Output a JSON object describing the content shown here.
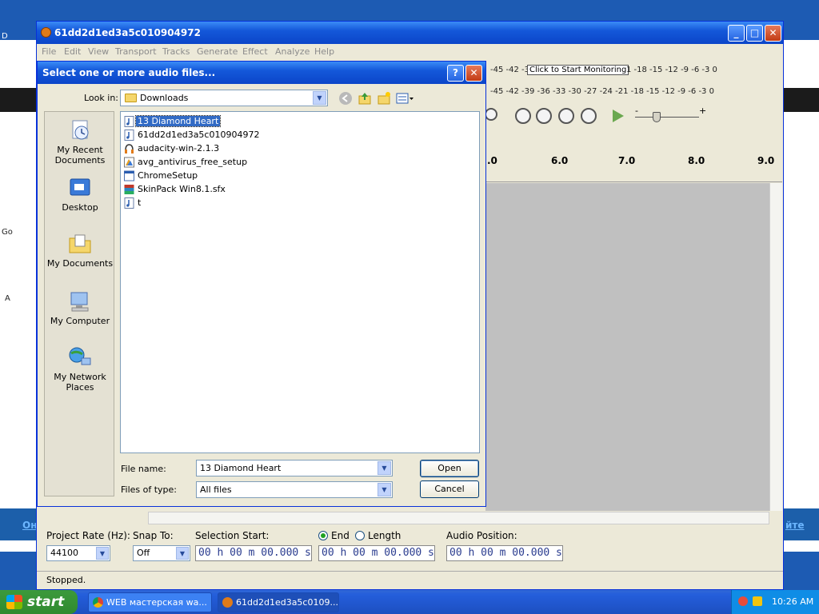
{
  "app": {
    "title": "61dd2d1ed3a5c010904972",
    "menu": [
      "File",
      "Edit",
      "View",
      "Transport",
      "Tracks",
      "Generate",
      "Effect",
      "Analyze",
      "Help"
    ],
    "meter_top": "-45 -42 -3",
    "meter_top_right": "1 -18 -15 -12  -9  -6  -3  0",
    "monitor_tip": "Click to Start Monitoring",
    "meter_bottom": "-45 -42 -39 -36 -33 -30 -27 -24 -21 -18 -15 -12  -9  -6  -3  0",
    "ruler": [
      ".0",
      "6.0",
      "7.0",
      "8.0",
      "9.0"
    ],
    "slider_minus": "-",
    "slider_plus": "+",
    "project_rate_label": "Project Rate (Hz):",
    "project_rate": "44100",
    "snap_to_label": "Snap To:",
    "snap_to": "Off",
    "selection_start_label": "Selection Start:",
    "end_label": "End",
    "length_label": "Length",
    "audio_position_label": "Audio Position:",
    "time_value": "00 h 00 m 00.000 s",
    "status": "Stopped."
  },
  "dialog": {
    "title": "Select one or more audio files...",
    "look_in_label": "Look in:",
    "look_in": "Downloads",
    "places": [
      "My Recent Documents",
      "Desktop",
      "My Documents",
      "My Computer",
      "My Network Places"
    ],
    "files": [
      "13 Diamond Heart",
      "61dd2d1ed3a5c010904972",
      "audacity-win-2.1.3",
      "avg_antivirus_free_setup",
      "ChromeSetup",
      "SkinPack Win8.1.sfx",
      "t"
    ],
    "file_name_label": "File name:",
    "file_name": "13 Diamond Heart",
    "file_type_label": "Files of type:",
    "file_type": "All files",
    "open": "Open",
    "cancel": "Cancel"
  },
  "taskbar": {
    "start": "start",
    "tasks": [
      "WEB мастерская wa...",
      "61dd2d1ed3a5c0109..."
    ],
    "clock": "10:26 AM"
  },
  "background": {
    "left_link": "Он",
    "right_link": "йте",
    "left_a": "Go",
    "left_b": "A",
    "left_c": "D"
  }
}
